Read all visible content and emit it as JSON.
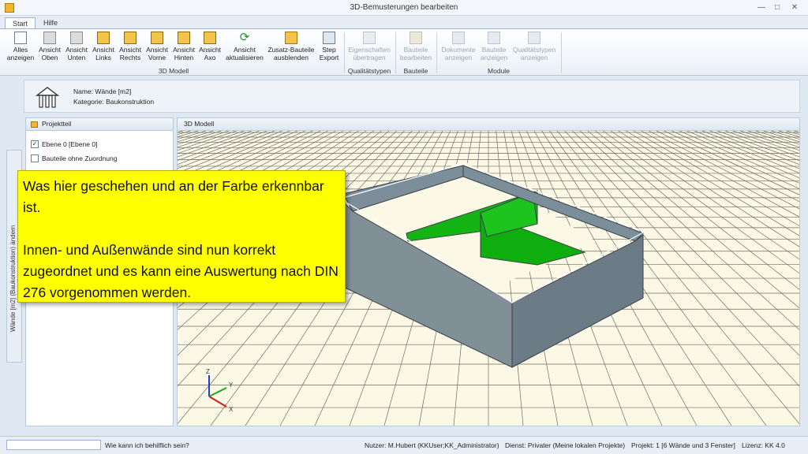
{
  "window": {
    "title": "3D-Bemusterungen bearbeiten"
  },
  "tabs": [
    "Start",
    "Hilfe"
  ],
  "ribbon": {
    "groups": {
      "model3d": "3D Modell",
      "quality": "Qualitätstypen",
      "parts": "Bauteile",
      "modules": "Module"
    },
    "buttons": {
      "alles": [
        "Alles",
        "anzeigen"
      ],
      "oben": [
        "Ansicht",
        "Oben"
      ],
      "unten": [
        "Ansicht",
        "Unten"
      ],
      "links": [
        "Ansicht",
        "Links"
      ],
      "rechts": [
        "Ansicht",
        "Rechts"
      ],
      "vorne": [
        "Ansicht",
        "Vorne"
      ],
      "hinten": [
        "Ansicht",
        "Hinten"
      ],
      "axo": [
        "Ansicht",
        "Axo"
      ],
      "aktualisieren": [
        "Ansicht",
        "aktualisieren"
      ],
      "zusatz": [
        "Zusatz-Bauteile",
        "ausblenden"
      ],
      "step": [
        "Step",
        "Export"
      ],
      "eigenschaften": [
        "Eigenschaften",
        "übertragen"
      ],
      "bauteile": [
        "Bauteile",
        "bearbeiten"
      ],
      "dokumente": [
        "Dokumente",
        "anzeigen"
      ],
      "bauteile_anz": [
        "Bauteile",
        "anzeigen"
      ],
      "qualitaet": [
        "Qualitätstypen",
        "anzeigen"
      ]
    }
  },
  "info": {
    "name": "Name: Wände [m2]",
    "category": "Kategorie: Baukonstruktion"
  },
  "sidebar_tab": "Wände [m2] (Baukonstruktion) ändern",
  "left_panel": {
    "title": "Projektteil",
    "items": [
      {
        "label": "Ebene 0 [Ebene 0]",
        "checked": "✓"
      },
      {
        "label": "Bauteile ohne Zuordnung",
        "checked": ""
      }
    ]
  },
  "model_panel": {
    "title": "3D Modell",
    "axes": {
      "z": "Z",
      "y": "Y",
      "x": "X"
    }
  },
  "callout": {
    "p1": "Was hier geschehen und an der Farbe erkennbar ist.",
    "p2": "Innen- und Außenwände sind nun korrekt zugeordnet und es kann eine Auswertung nach DIN 276 vorgenommen werden."
  },
  "status": {
    "help": "Wie kann ich behilflich sein?",
    "user": "Nutzer: M.Hubert (KKUser;KK_Administrator)",
    "service": "Dienst: Privater (Meine lokalen Projekte)",
    "project": "Projekt: 1 [6 Wände und 3 Fenster]",
    "license": "Lizenz: KK 4.0"
  },
  "colors": {
    "wall": "#7c8e99",
    "inner_wall": "#14b414",
    "callout": "#ffff00",
    "grid_bg": "#fbf9e6"
  }
}
